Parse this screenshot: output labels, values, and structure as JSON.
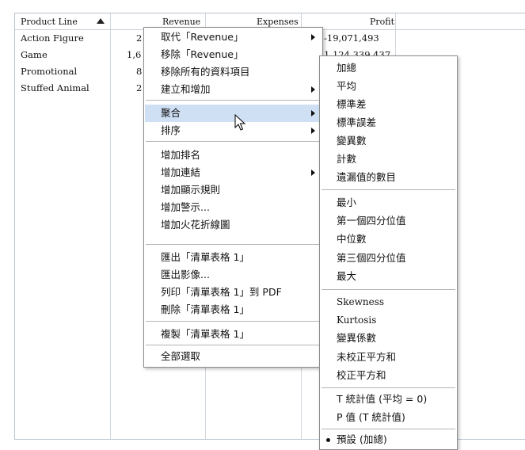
{
  "table": {
    "columns": [
      "Product Line",
      "Revenue",
      "Expenses",
      "Profit"
    ],
    "rows": [
      {
        "product_line": "Action Figure",
        "revenue": "2",
        "profit": "-19,071,493"
      },
      {
        "product_line": "Game",
        "revenue": "1,6",
        "profit": "1,124,339,437"
      },
      {
        "product_line": "Promotional",
        "revenue": "8",
        "profit": ""
      },
      {
        "product_line": "Stuffed Animal",
        "revenue": "2",
        "profit": ""
      }
    ]
  },
  "context_menu": {
    "items": [
      "取代「Revenue」",
      "移除「Revenue」",
      "移除所有的資料項目",
      "建立和增加",
      "聚合",
      "排序",
      "增加排名",
      "增加連結",
      "增加顯示規則",
      "增加警示...",
      "增加火花折線圖",
      "匯出「清單表格 1」",
      "匯出影像...",
      "列印「清單表格 1」到 PDF",
      "刪除「清單表格 1」",
      "複製「清單表格 1」",
      "全部選取"
    ]
  },
  "aggregate_submenu": {
    "items": [
      "加總",
      "平均",
      "標準差",
      "標準誤差",
      "變異數",
      "計數",
      "遺漏值的數目",
      "最小",
      "第一個四分位值",
      "中位數",
      "第三個四分位值",
      "最大",
      "Skewness",
      "Kurtosis",
      "變異係數",
      "未校正平方和",
      "校正平方和",
      "T 統計值 (平均 = 0)",
      "P 值 (T 統計值)",
      "預設 (加總)"
    ]
  }
}
